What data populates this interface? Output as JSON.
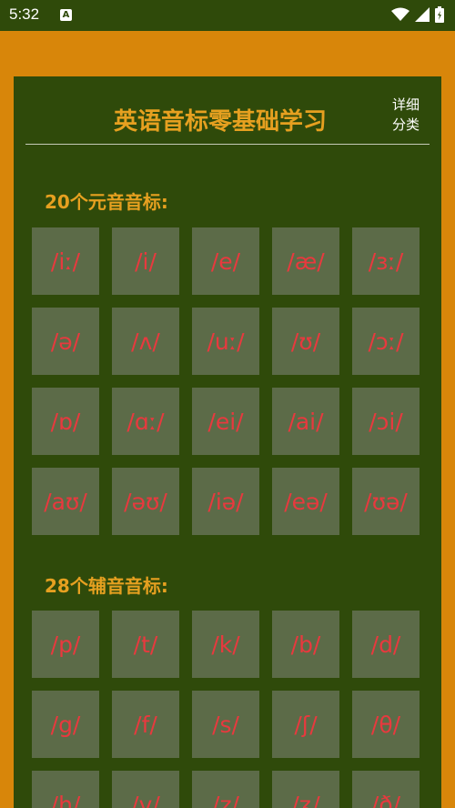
{
  "status": {
    "time": "5:32",
    "notif_icon": "A"
  },
  "header": {
    "title": "英语音标零基础学习",
    "detail_button": "详细\n分类"
  },
  "vowels": {
    "heading": "20个元音音标:",
    "items": [
      "/iː/",
      "/i/",
      "/e/",
      "/æ/",
      "/ɜː/",
      "/ə/",
      "/ʌ/",
      "/uː/",
      "/ʊ/",
      "/ɔː/",
      "/ɒ/",
      "/ɑː/",
      "/ei/",
      "/ai/",
      "/ɔi/",
      "/aʊ/",
      "/əʊ/",
      "/iə/",
      "/eə/",
      "/ʊə/"
    ]
  },
  "consonants": {
    "heading": "28个辅音音标:",
    "items": [
      "/p/",
      "/t/",
      "/k/",
      "/b/",
      "/d/",
      "/g/",
      "/f/",
      "/s/",
      "/ʃ/",
      "/θ/",
      "/h/",
      "/v/",
      "/z/",
      "/ʒ/",
      "/ð/"
    ]
  },
  "colors": {
    "frame": "#d8860a",
    "board": "#2f4a0a",
    "heading": "#e6a020",
    "cell": "#5c6b48",
    "symbol": "#e8393e"
  }
}
